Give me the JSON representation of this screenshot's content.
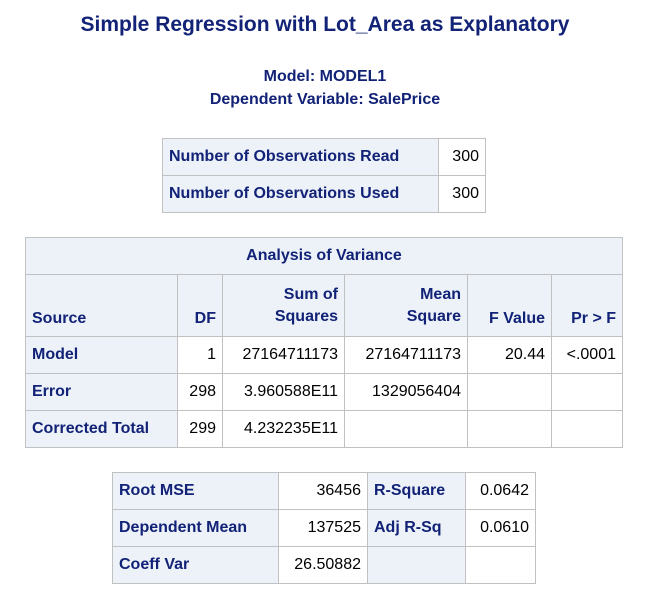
{
  "title": "Simple Regression with Lot_Area as Explanatory",
  "model_line": "Model: MODEL1",
  "dependent_line": "Dependent Variable: SalePrice",
  "observations": [
    {
      "label": "Number of Observations Read",
      "value": "300"
    },
    {
      "label": "Number of Observations Used",
      "value": "300"
    }
  ],
  "anova": {
    "caption": "Analysis of Variance",
    "headers": {
      "source": "Source",
      "df": "DF",
      "ss1": "Sum of",
      "ss2": "Squares",
      "ms1": "Mean",
      "ms2": "Square",
      "f": "F Value",
      "p": "Pr > F"
    },
    "rows": [
      {
        "source": "Model",
        "df": "1",
        "ss": "27164711173",
        "ms": "27164711173",
        "f": "20.44",
        "p": "<.0001"
      },
      {
        "source": "Error",
        "df": "298",
        "ss": "3.960588E11",
        "ms": "1329056404",
        "f": "",
        "p": ""
      },
      {
        "source": "Corrected Total",
        "df": "299",
        "ss": "4.232235E11",
        "ms": "",
        "f": "",
        "p": ""
      }
    ]
  },
  "fit": [
    {
      "label1": "Root MSE",
      "value1": "36456",
      "label2": "R-Square",
      "value2": "0.0642"
    },
    {
      "label1": "Dependent Mean",
      "value1": "137525",
      "label2": "Adj R-Sq",
      "value2": "0.0610"
    },
    {
      "label1": "Coeff Var",
      "value1": "26.50882",
      "label2": "",
      "value2": ""
    }
  ]
}
